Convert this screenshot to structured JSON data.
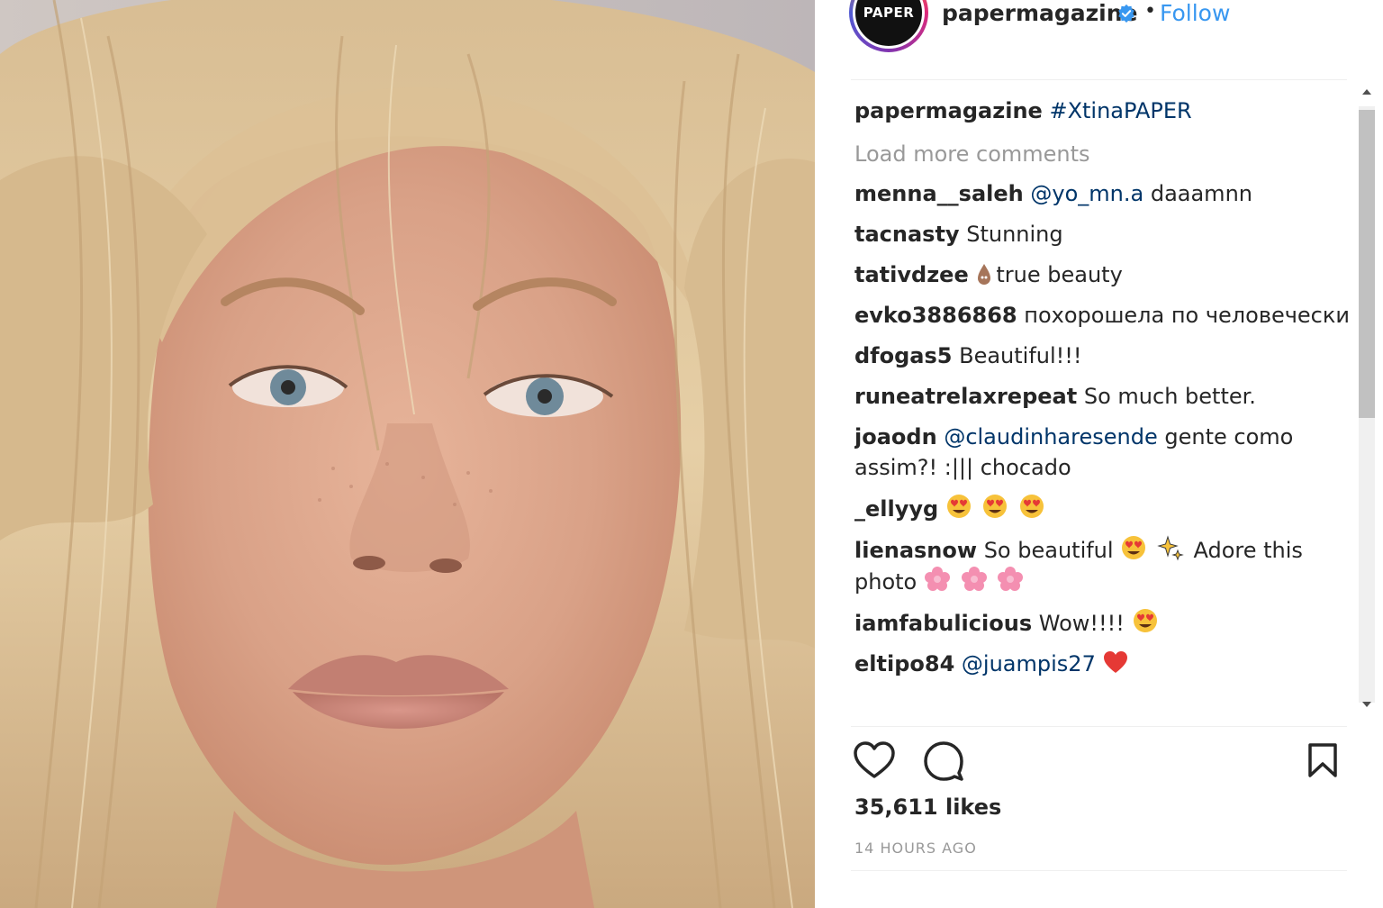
{
  "header": {
    "avatar_text": "PAPER",
    "username": "papermagazine",
    "separator": "•",
    "follow_label": "Follow"
  },
  "caption": {
    "username": "papermagazine",
    "hashtag": "#XtinaPAPER"
  },
  "load_more_label": "Load more comments",
  "comments": [
    {
      "user": "menna__saleh",
      "mention": "@yo_mn.a",
      "text": "daaamnn"
    },
    {
      "user": "tacnasty",
      "text": "Stunning"
    },
    {
      "user": "tativdzee",
      "text": "true beauty"
    },
    {
      "user": "evko3886868",
      "text": "похорошела по человечески"
    },
    {
      "user": "dfogas5",
      "text": "Beautiful!!!"
    },
    {
      "user": "runeatrelaxrepeat",
      "text": "So much better."
    },
    {
      "user": "joaodn",
      "mention": "@claudinharesende",
      "text": "gente como assim?! :||| chocado"
    },
    {
      "user": "_ellyyg",
      "text": ""
    },
    {
      "user": "lienasnow",
      "text_a": "So beautiful",
      "text_b": "Adore this photo"
    },
    {
      "user": "iamfabulicious",
      "text": "Wow!!!!"
    },
    {
      "user": "eltipo84",
      "mention": "@juampis27",
      "text": ""
    }
  ],
  "icons": {
    "verified": "verified-badge-icon",
    "like": "heart-outline-icon",
    "comment": "speech-bubble-icon",
    "save": "bookmark-icon"
  },
  "likes_text": "35,611 likes",
  "timestamp": "14 HOURS AGO",
  "colors": {
    "link": "#3897f0",
    "mention": "#003569",
    "muted": "#999999",
    "text": "#262626"
  }
}
